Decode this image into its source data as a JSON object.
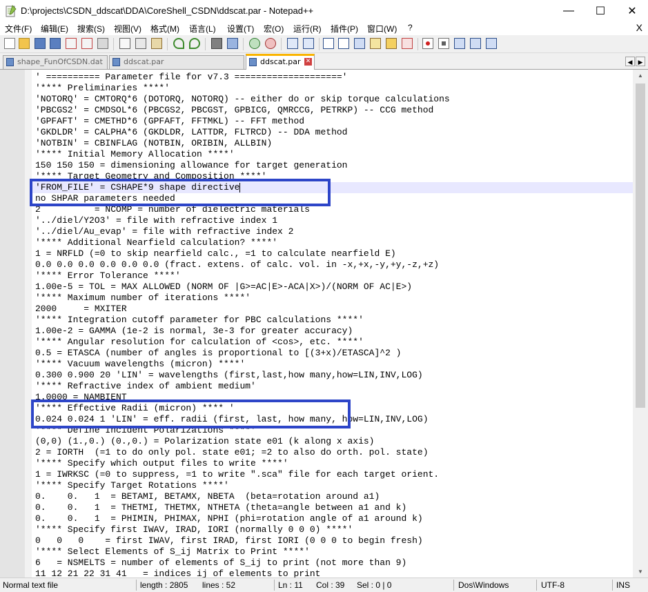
{
  "window": {
    "title": "D:\\projects\\CSDN_ddscat\\DDA\\CoreShell_CSDN\\ddscat.par - Notepad++",
    "minimize": "—",
    "maximize": "☐",
    "close": "✕"
  },
  "menu": {
    "items": [
      "文件(F)",
      "编辑(E)",
      "搜索(S)",
      "视图(V)",
      "格式(M)",
      "语言(L)",
      "设置(T)",
      "宏(O)",
      "运行(R)",
      "插件(P)",
      "窗口(W)",
      "?"
    ],
    "close": "X"
  },
  "tabs": [
    {
      "label": "shape_FunOfCSDN.dat"
    },
    {
      "label": "ddscat.par"
    },
    {
      "label": "ddscat.par"
    }
  ],
  "editor": {
    "lines": [
      "' ========== Parameter file for v7.3 ===================='",
      "'**** Preliminaries ****'",
      "'NOTORQ' = CMTORQ*6 (DOTORQ, NOTORQ) -- either do or skip torque calculations",
      "'PBCGS2' = CMDSOL*6 (PBCGS2, PBCGST, GPBICG, QMRCCG, PETRKP) -- CCG method",
      "'GPFAFT' = CMETHD*6 (GPFAFT, FFTMKL) -- FFT method",
      "'GKDLDR' = CALPHA*6 (GKDLDR, LATTDR, FLTRCD) -- DDA method",
      "'NOTBIN' = CBINFLAG (NOTBIN, ORIBIN, ALLBIN)",
      "'**** Initial Memory Allocation ****'",
      "150 150 150 = dimensioning allowance for target generation",
      "'**** Target Geometry and Composition ****'",
      "'FROM_FILE' = CSHAPE*9 shape directive",
      "no SHPAR parameters needed",
      "2          = NCOMP = number of dielectric materials",
      "'../diel/Y2O3' = file with refractive index 1",
      "'../diel/Au_evap' = file with refractive index 2",
      "'**** Additional Nearfield calculation? ****'",
      "1 = NRFLD (=0 to skip nearfield calc., =1 to calculate nearfield E)",
      "0.0 0.0 0.0 0.0 0.0 0.0 (fract. extens. of calc. vol. in -x,+x,-y,+y,-z,+z)",
      "'**** Error Tolerance ****'",
      "1.00e-5 = TOL = MAX ALLOWED (NORM OF |G>=AC|E>-ACA|X>)/(NORM OF AC|E>)",
      "'**** Maximum number of iterations ****'",
      "2000     = MXITER",
      "'**** Integration cutoff parameter for PBC calculations ****'",
      "1.00e-2 = GAMMA (1e-2 is normal, 3e-3 for greater accuracy)",
      "'**** Angular resolution for calculation of <cos>, etc. ****'",
      "0.5 = ETASCA (number of angles is proportional to [(3+x)/ETASCA]^2 )",
      "'**** Vacuum wavelengths (micron) ****'",
      "0.300 0.900 20 'LIN' = wavelengths (first,last,how many,how=LIN,INV,LOG)",
      "'**** Refractive index of ambient medium'",
      "1.0000 = NAMBIENT",
      "'**** Effective Radii (micron) **** '",
      "0.024 0.024 1 'LIN' = eff. radii (first, last, how many, how=LIN,INV,LOG)",
      "'**** Define Incident Polarizations ****'",
      "(0,0) (1.,0.) (0.,0.) = Polarization state e01 (k along x axis)",
      "2 = IORTH  (=1 to do only pol. state e01; =2 to also do orth. pol. state)",
      "'**** Specify which output files to write ****'",
      "1 = IWRKSC (=0 to suppress, =1 to write \".sca\" file for each target orient.",
      "'**** Specify Target Rotations ****'",
      "0.    0.   1  = BETAMI, BETAMX, NBETA  (beta=rotation around a1)",
      "0.    0.   1  = THETMI, THETMX, NTHETA (theta=angle between a1 and k)",
      "0.    0.   1  = PHIMIN, PHIMAX, NPHI (phi=rotation angle of a1 around k)",
      "'**** Specify first IWAV, IRAD, IORI (normally 0 0 0) ****'",
      "0   0   0    = first IWAV, first IRAD, first IORI (0 0 0 to begin fresh)",
      "'**** Select Elements of S_ij Matrix to Print ****'",
      "6   = NSMELTS = number of elements of S_ij to print (not more than 9)",
      "11 12 21 22 31 41   = indices ij of elements to print"
    ],
    "current_line": 11,
    "current_col": 39
  },
  "status": {
    "file_type": "Normal text file",
    "length": "length : 2805",
    "lines": "lines : 52",
    "ln": "Ln : 11",
    "col": "Col : 39",
    "sel": "Sel : 0 | 0",
    "eol": "Dos\\Windows",
    "encoding": "UTF-8",
    "mode": "INS"
  },
  "colors": {
    "highlight_box": "#2d45c8",
    "current_line": "#e8e8ff",
    "active_tab_accent": "#fab400"
  }
}
